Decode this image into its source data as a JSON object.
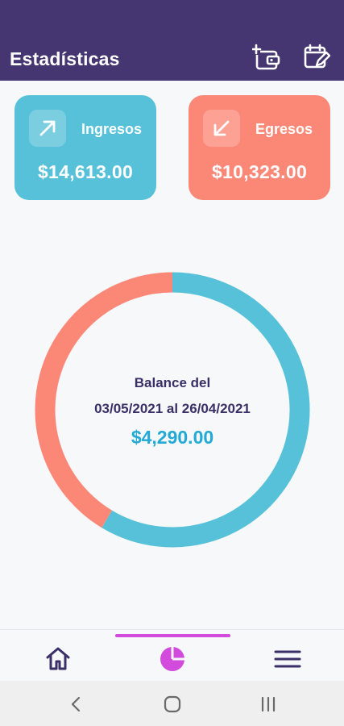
{
  "app_bar": {
    "title": "Estadísticas",
    "actions": [
      {
        "name": "add-wallet-icon"
      },
      {
        "name": "calendar-edit-icon"
      }
    ]
  },
  "cards": {
    "income": {
      "label": "Ingresos",
      "amount": "$14,613.00",
      "icon": "arrow-up-right-icon",
      "color": "#56c1d8"
    },
    "expense": {
      "label": "Egresos",
      "amount": "$10,323.00",
      "icon": "arrow-down-left-icon",
      "color": "#fb8777"
    }
  },
  "balance": {
    "title": "Balance del",
    "range": "03/05/2021 al 26/04/2021",
    "amount": "$4,290.00"
  },
  "chart_data": {
    "type": "pie",
    "style": "donut",
    "title": "",
    "series": [
      {
        "name": "Ingresos",
        "value": 14613.0,
        "color": "#56c1d8"
      },
      {
        "name": "Egresos",
        "value": 10323.0,
        "color": "#fb8777"
      }
    ]
  },
  "bottom_nav": {
    "items": [
      {
        "name": "home-icon",
        "active": false
      },
      {
        "name": "pie-chart-icon",
        "active": true
      },
      {
        "name": "menu-icon",
        "active": false
      }
    ],
    "active_color": "#d24bdc",
    "icon_color": "#3a2f66"
  },
  "system_nav": {
    "buttons": [
      "back-icon",
      "home-circle-icon",
      "recents-icon"
    ]
  },
  "colors": {
    "header": "#453570",
    "background": "#f6f8f9",
    "balance_amount": "#22a9d6",
    "text_dark": "#3a2f66"
  }
}
